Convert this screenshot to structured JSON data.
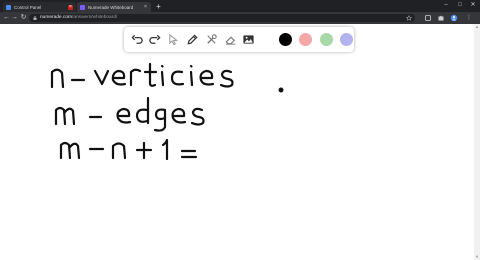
{
  "browser": {
    "tabs": [
      {
        "title": "Control Panel",
        "active": false,
        "favicon_color": "#4a8af4"
      },
      {
        "title": "Numerade Whiteboard",
        "active": true,
        "favicon_color": "#7b5cff"
      }
    ],
    "new_tab_glyph": "+",
    "window_controls": [
      "–",
      "□",
      "✕"
    ],
    "nav": {
      "back": "←",
      "forward": "→",
      "reload": "↻"
    },
    "address": {
      "host": "numerade.com",
      "path": "/answers/whiteboard/"
    }
  },
  "whiteboard": {
    "tools": [
      "undo-icon",
      "redo-icon",
      "select-arrow-icon",
      "pen-icon",
      "tools-icon",
      "eraser-icon",
      "image-icon"
    ],
    "colors": [
      "#000000",
      "#f4a7a7",
      "#a8d8a8",
      "#b3b3f0"
    ],
    "handwriting": [
      "n - vertices",
      "m - edges",
      "m - n + 1 ="
    ]
  }
}
